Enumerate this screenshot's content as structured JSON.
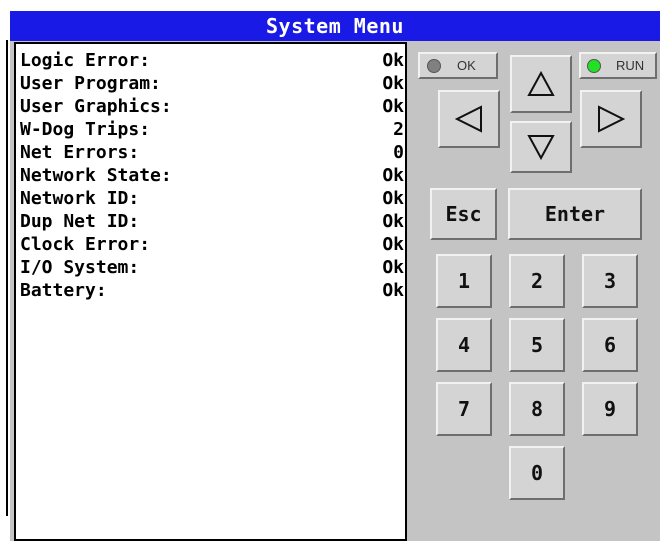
{
  "title": "System Menu",
  "status_rows": [
    {
      "label": "Logic Error:",
      "value": "Ok"
    },
    {
      "label": "User Program:",
      "value": "Ok"
    },
    {
      "label": "User Graphics:",
      "value": "Ok"
    },
    {
      "label": "W-Dog Trips:",
      "value": "2"
    },
    {
      "label": "Net Errors:",
      "value": "0"
    },
    {
      "label": "Network State:",
      "value": "Ok"
    },
    {
      "label": "Network ID:",
      "value": "Ok"
    },
    {
      "label": "Dup Net ID:",
      "value": "Ok"
    },
    {
      "label": "Clock Error:",
      "value": "Ok"
    },
    {
      "label": "I/O System:",
      "value": "Ok"
    },
    {
      "label": "Battery:",
      "value": "Ok"
    }
  ],
  "indicators": {
    "ok": {
      "label": "OK",
      "led_color": "#808080"
    },
    "run": {
      "label": "RUN",
      "led_color": "#22e022"
    }
  },
  "keys": {
    "esc": "Esc",
    "enter": "Enter",
    "k1": "1",
    "k2": "2",
    "k3": "3",
    "k4": "4",
    "k5": "5",
    "k6": "6",
    "k7": "7",
    "k8": "8",
    "k9": "9",
    "k0": "0"
  },
  "arrow_icons": [
    "arrow-up-icon",
    "arrow-left-icon",
    "arrow-right-icon",
    "arrow-down-icon"
  ]
}
